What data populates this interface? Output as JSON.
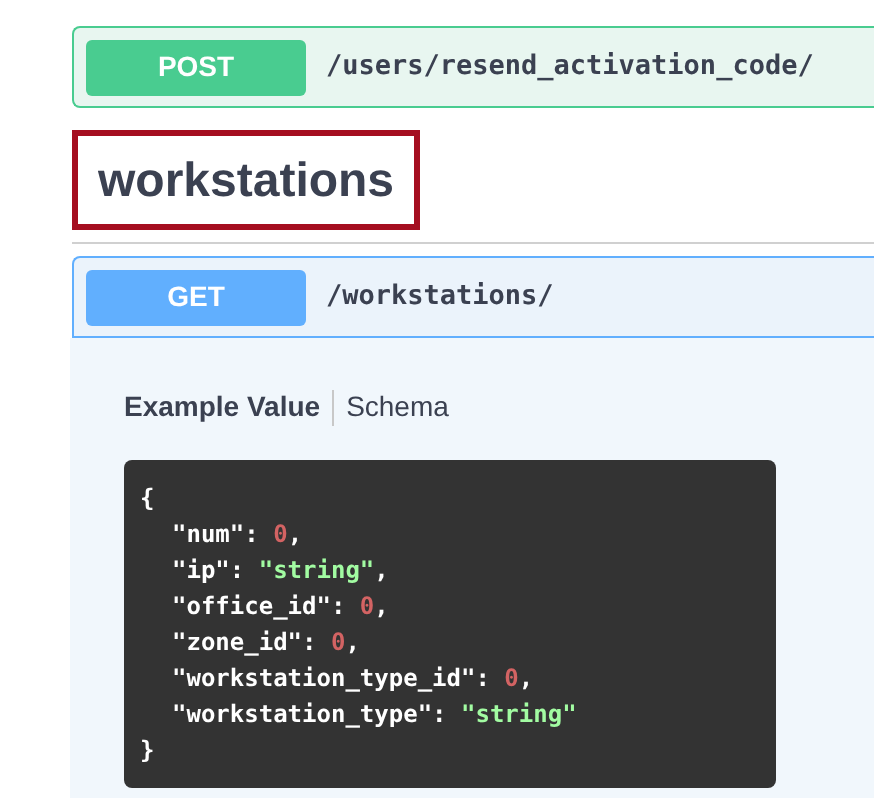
{
  "operations": [
    {
      "method": "POST",
      "path": "/users/resend_activation_code/",
      "selected": false
    },
    {
      "section": "workstations",
      "highlighted": true
    },
    {
      "method": "GET",
      "path": "/workstations/",
      "selected": true
    }
  ],
  "example_tabs": [
    {
      "label": "Example Value",
      "selected": true
    },
    {
      "label": "Schema",
      "selected": false
    }
  ],
  "example_code": {
    "open": "{",
    "close": "}",
    "entries": [
      {
        "key": "\"num\":",
        "value": "0",
        "kind": "number",
        "trail": ","
      },
      {
        "key": "\"ip\":",
        "value": "\"string\"",
        "kind": "string",
        "trail": ","
      },
      {
        "key": "\"office_id\":",
        "value": "0",
        "kind": "number",
        "trail": ","
      },
      {
        "key": "\"zone_id\":",
        "value": "0",
        "kind": "number",
        "trail": ","
      },
      {
        "key": "\"workstation_type_id\":",
        "value": "0",
        "kind": "number",
        "trail": ","
      },
      {
        "key": "\"workstation_type\":",
        "value": "\"string\"",
        "kind": "string"
      }
    ]
  }
}
